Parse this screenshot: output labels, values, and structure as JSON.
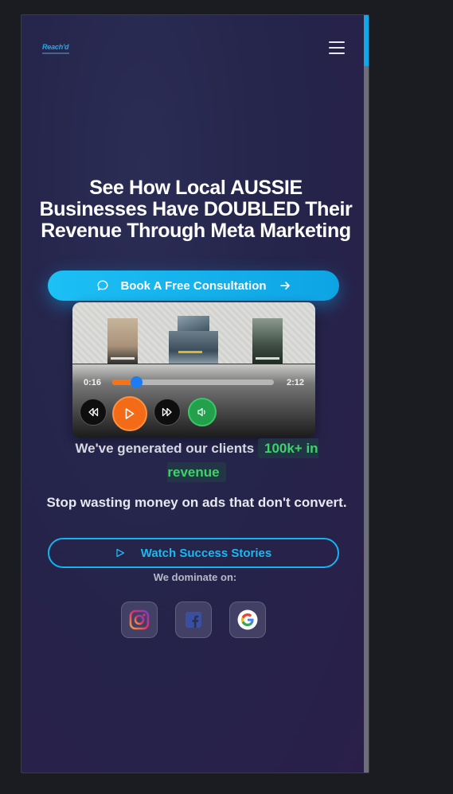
{
  "header": {
    "logo_text": "Reach'd",
    "menu_icon": "hamburger-icon"
  },
  "hero": {
    "headline": "See How Local AUSSIE Businesses Have DOUBLED Their Revenue Through Meta Marketing",
    "cta_label": "Book A Free Consultation",
    "cta_icon": "chat-bubble-icon",
    "cta_arrow_icon": "arrow-right-icon"
  },
  "player": {
    "current_time": "0:16",
    "duration": "2:12",
    "progress": 0.15
  },
  "stats": {
    "prefix": "We've generated our clients",
    "highlight": "100k+ in revenue",
    "tagline": "Stop wasting money on ads that don't convert."
  },
  "secondary_cta": {
    "label": "Watch Success Stories",
    "icon": "play-outline-icon"
  },
  "platforms": {
    "heading": "We dominate on:",
    "items": [
      "instagram-icon",
      "facebook-icon",
      "google-icon"
    ]
  },
  "colors": {
    "accent": "#0ea5e9",
    "highlight_green": "#3fd26b",
    "play_orange": "#f36b16"
  }
}
